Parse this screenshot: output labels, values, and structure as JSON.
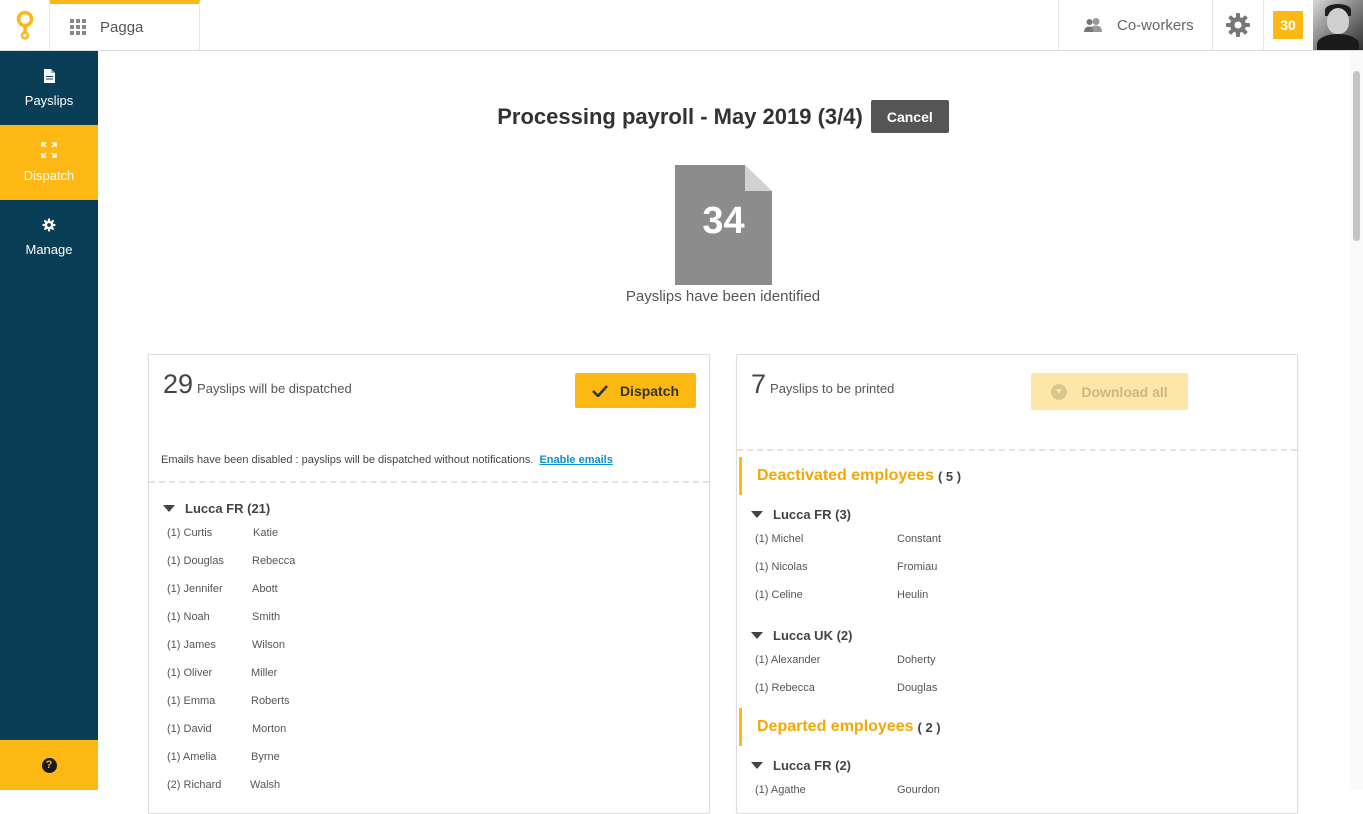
{
  "topbar": {
    "app_name": "Pagga",
    "coworkers_label": "Co-workers",
    "notification_count": "30"
  },
  "sidebar": {
    "items": [
      {
        "label": "Payslips",
        "icon": "document-icon"
      },
      {
        "label": "Dispatch",
        "icon": "expand-arrows-icon",
        "active": true
      },
      {
        "label": "Manage",
        "icon": "gear-icon"
      }
    ],
    "help_label": "?"
  },
  "header": {
    "title": "Processing payroll - May 2019 (3/4)",
    "cancel_label": "Cancel"
  },
  "summary": {
    "count": "34",
    "label": "Payslips have been identified"
  },
  "dispatch_panel": {
    "count": "29",
    "label": "Payslips will be dispatched",
    "button_label": "Dispatch",
    "email_note": "Emails have been disabled : payslips will be dispatched without notifications.",
    "email_link": "Enable emails",
    "groups": [
      {
        "name": "Lucca FR (21)",
        "rows": [
          {
            "first": "(1) Curtis",
            "last": "Katie"
          },
          {
            "first": "(1) Douglas",
            "last": "Rebecca"
          },
          {
            "first": "(1) Jennifer",
            "last": "Abott"
          },
          {
            "first": "(1) Noah",
            "last": "Smith"
          },
          {
            "first": "(1) James",
            "last": "Wilson"
          },
          {
            "first": "(1) Oliver",
            "last": "Miller"
          },
          {
            "first": "(1) Emma",
            "last": "Roberts"
          },
          {
            "first": "(1) David",
            "last": "Morton"
          },
          {
            "first": "(1) Amelia",
            "last": "Byrne"
          },
          {
            "first": "(2) Richard",
            "last": "Walsh"
          }
        ]
      }
    ]
  },
  "print_panel": {
    "count": "7",
    "label": "Payslips to be printed",
    "button_label": "Download all",
    "sections": [
      {
        "name": "Deactivated employees",
        "count": "( 5 )",
        "groups": [
          {
            "name": "Lucca FR (3)",
            "rows": [
              {
                "first": "(1) Michel",
                "last": "Constant"
              },
              {
                "first": "(1) Nicolas",
                "last": "Fromiau"
              },
              {
                "first": "(1) Celine",
                "last": "Heulin"
              }
            ]
          },
          {
            "name": "Lucca UK (2)",
            "rows": [
              {
                "first": "(1) Alexander",
                "last": "Doherty"
              },
              {
                "first": "(1) Rebecca",
                "last": "Douglas"
              }
            ]
          }
        ]
      },
      {
        "name": "Departed employees",
        "count": "( 2 )",
        "groups": [
          {
            "name": "Lucca FR (2)",
            "rows": [
              {
                "first": "(1) Agathe",
                "last": "Gourdon"
              }
            ]
          }
        ]
      }
    ]
  },
  "colors": {
    "accent": "#fdb813",
    "sidebar": "#0a3d56",
    "section_title": "#f5a800",
    "link": "#0a8fcf"
  }
}
